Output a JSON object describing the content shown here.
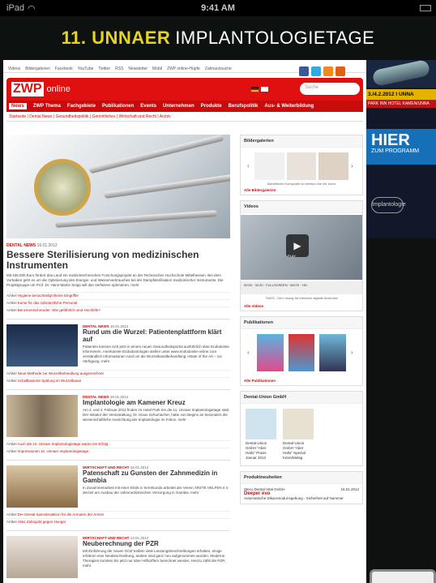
{
  "status": {
    "device": "iPad",
    "time": "9:41 AM"
  },
  "banner": {
    "part1": "11. UNNAER",
    "part2": "IMPLANTOLOGIETAGE"
  },
  "topnav": [
    "Videos",
    "Bildergalerien",
    "Facebook",
    "YouTube",
    "Twitter",
    "RSS",
    "Newsletter",
    "Mobil",
    "ZWP online-Hüpfe",
    "Zahnarztsuche"
  ],
  "logo": {
    "zwp": "ZWP",
    "online": "online"
  },
  "search": {
    "placeholder": "Suche"
  },
  "menu": [
    "News",
    "ZWP Thema",
    "Fachgebiete",
    "Publikationen",
    "Events",
    "Unternehmen",
    "Produkte",
    "Berufspolitik",
    "Aus- & Weiterbildung"
  ],
  "submenu": "Startseite | Dental News | Gesundheitspolitik | Gerichtliches | Wirtschaft und Recht | Archiv",
  "lead": {
    "category": "DENTAL NEWS",
    "date": "16.01.2012",
    "title": "Bessere Sterilisierung von medizinischen Instrumenten",
    "body": "Mit 436.000 Euro fördert das Land ein medizintechnisches Forschungsprojekt an der Technischen Hochschule Mittelhessen. Bei dem Vorhaben geht es um die Optimierung des Energie- und Wasserverbrauches bei der Dampfsterilisation medizinischer Instrumente. Die Projektgruppe um Prof. Dr. Hans-Martin Seipp will das Verfahren optimieren. mehr",
    "links": [
      {
        "label": "Artikel",
        "text": "Hygiene benachteiligt kleine Eingriffer"
      },
      {
        "label": "Artikel",
        "text": "Kurse für das zahnärztliche Personal"
      },
      {
        "label": "Artikel",
        "text": "Benzinentschreuder: Wie gefährlich sind Hochlöfe?"
      }
    ]
  },
  "items": [
    {
      "category": "DENTAL NEWS",
      "date": "16.01.2012",
      "title": "Rund um die Wurzel: Patientenplattform klärt auf",
      "body": "Patienten können sich jetzt in einem neuen Gesundheitsportal ausführlich über Endodontie informieren. Anerkannte Endodontologen stellen unter www.endodontie-online.com verständlich Informationen rund um die Wurzelkanalbehandlung »State of the Art – zur Verfügung. mehr",
      "links": [
        "Neue Methode zur Wurzelbehandlung ausgezeichnet",
        "Schallbasierte Spülung im Wurzelkanal"
      ]
    },
    {
      "category": "DENTAL NEWS",
      "date": "16.01.2012",
      "title": "Implantologie am Kamener Kreuz",
      "body": "Am 3. und 4. Februar 2012 finden im Hotel Park Inn die 11. Unnaer Implantologietage statt. Der Initiator der Veranstaltung, Dr. Klaus Schumacher, hatte von Beginn an besonders die wissenschaftliche Ausrichtung der Implantologie im Fokus. mehr",
      "links": [
        "Auch die 10. Unnaer Implantologietage waren ein Erfolg",
        "Impressionen 10. Unnaer Implantologietage"
      ]
    },
    {
      "category": "WIRTSCHAFT UND RECHT",
      "date": "16.01.2012",
      "title": "Patenschaft zu Gunsten der Zahnmedizin in Gambia",
      "body": "In Zusammenarbeit mit einer Klinik in Serrekunda arbeitet der Verein ÄRZTE HELFEN e.V. derzeit am Ausbau der zahnmedizinischen Versorgung in Gambia. mehr",
      "links": [
        "Der Dental Spendenaktion für die Armuten der Armen",
        "Altes Zahngold gegen Hunger"
      ]
    },
    {
      "category": "WIRTSCHAFT UND RECHT",
      "date": "13.01.2012",
      "title": "Neuberechnung der PZR",
      "body": "Mit Einführung der neuen GOZ treiben viele Leistungsbeschreibungen erhalten, einige erfahren eine Neubeschreibung, andere sind ganz neu aufgenommen worden. Moderne Therapien konnten bis jetzt nur über Hilfsziffern berechnet werden. Hierzu zählt die PZR. mehr",
      "links": []
    }
  ],
  "sidebar": {
    "gallery": {
      "title": "Bildergalerien",
      "caption": "Ästhetische Komposite so einfach wie nie zuvor",
      "more": "Alle Bildergalerien"
    },
    "videos": {
      "title": "Videos",
      "play": "PLAY",
      "time_start": "00:00",
      "time_end": "00:30",
      "caption": "TMOS - Die Lösung für intensive digitale Abdrücke",
      "more": "Alle Videos",
      "controls": "FULLSCREEN · MUTE · HD"
    },
    "pubs": {
      "title": "Publikationen",
      "more": "Alle Publikationen"
    },
    "du": {
      "title": "Dental-Union GmbH",
      "items": [
        "Dental-Union GmbH \"Aber Hallo\" Praxis Januar 2012",
        "Dental-Union GmbH \"Aber Hallo\" Spezial KaVo/Melag"
      ]
    },
    "prod": {
      "title": "Produktneuheiten",
      "company": "Steco Dental-Vital GmbH",
      "date": "16.01.2012",
      "name": "Deeper evo",
      "desc": "Automatische Dikaromodul-egebung - Sicherheit auf Nummer"
    }
  },
  "ad": {
    "date": "3./4.2.2012 I UNNA",
    "place": "PARK INN HOTEL KAMEN/UNNA",
    "hier": "HIER",
    "sub": "ZUM PROGRAMM",
    "logo": "Implantologie"
  }
}
